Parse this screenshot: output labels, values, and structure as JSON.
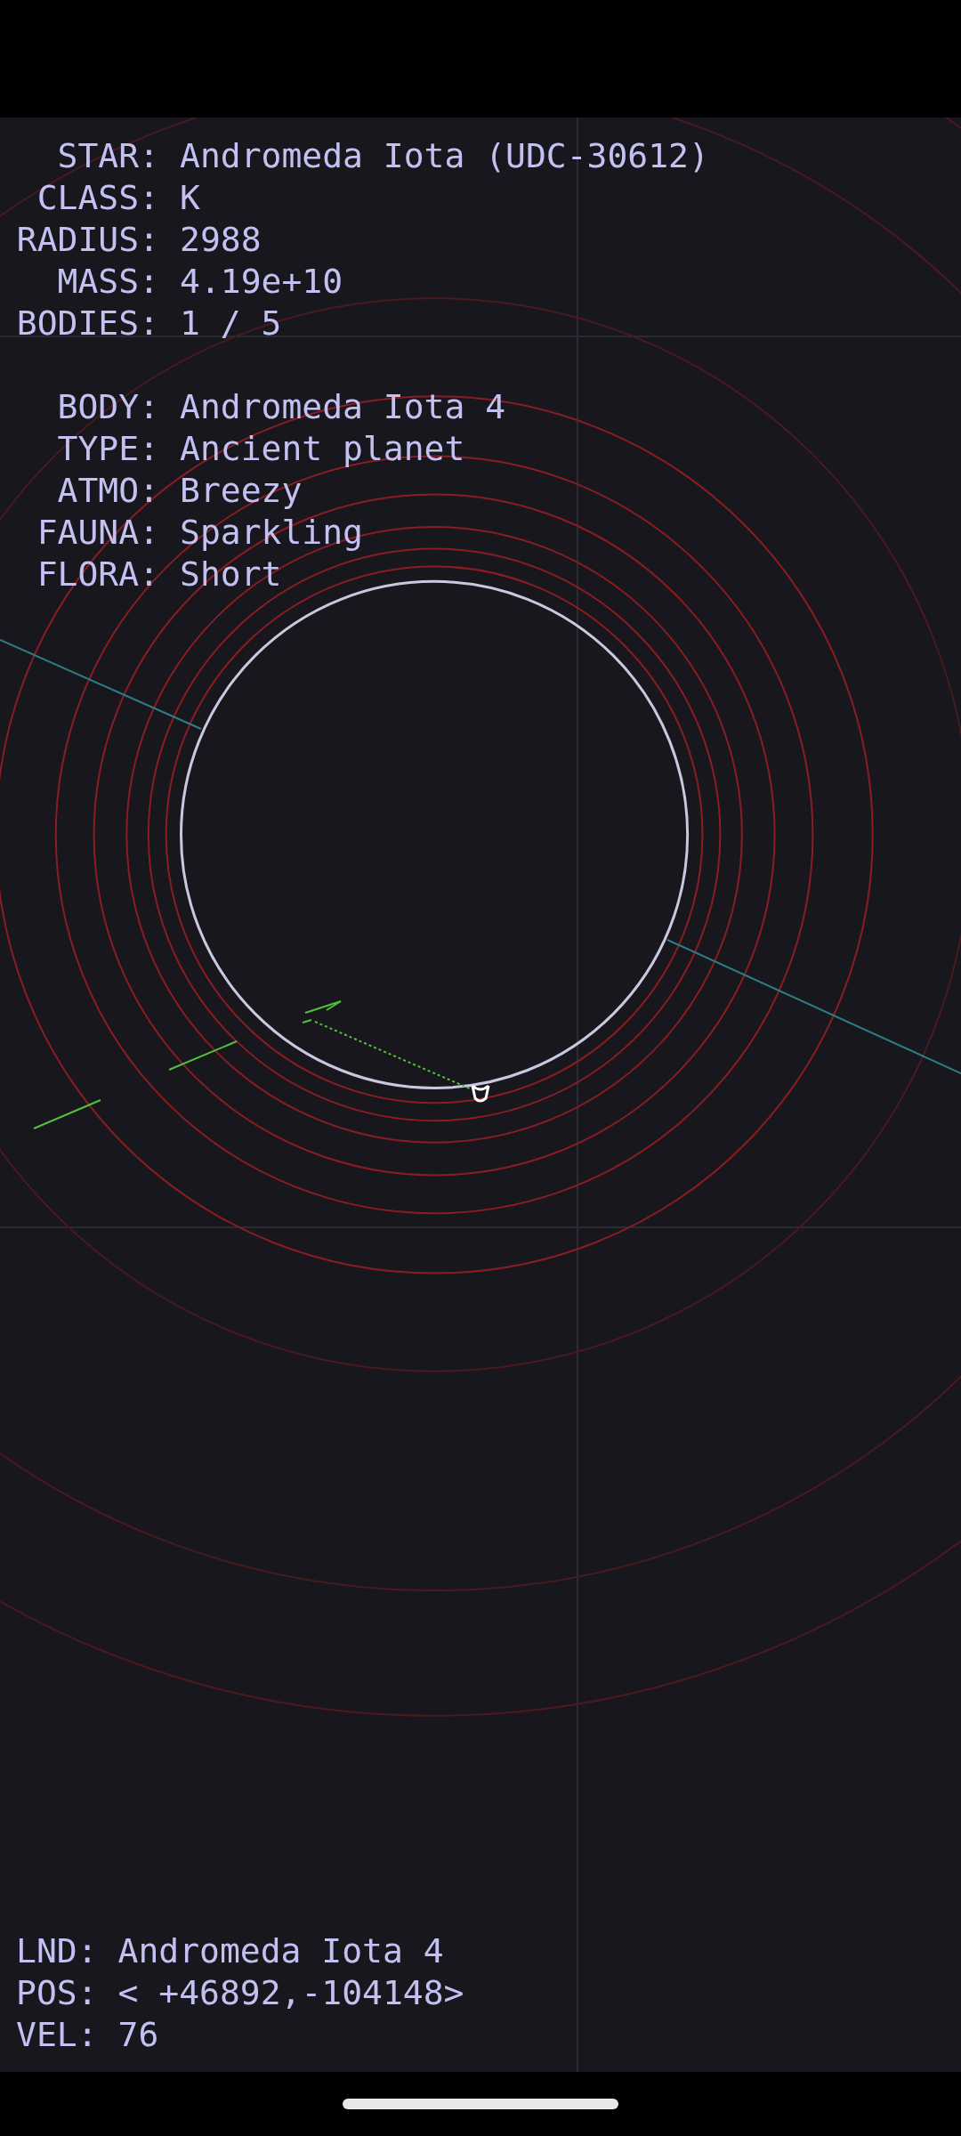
{
  "star": [
    {
      "label": "STAR:",
      "value": "Andromeda Iota (UDC-30612)"
    },
    {
      "label": "CLASS:",
      "value": "K"
    },
    {
      "label": "RADIUS:",
      "value": "2988"
    },
    {
      "label": "MASS:",
      "value": "4.19e+10"
    },
    {
      "label": "BODIES:",
      "value": "1 / 5"
    }
  ],
  "body": [
    {
      "label": "BODY:",
      "value": "Andromeda Iota 4"
    },
    {
      "label": "TYPE:",
      "value": "Ancient planet"
    },
    {
      "label": "ATMO:",
      "value": "Breezy"
    },
    {
      "label": "FAUNA:",
      "value": "Sparkling"
    },
    {
      "label": "FLORA:",
      "value": "Short"
    }
  ],
  "status": [
    {
      "label": "LND:",
      "value": "Andromeda Iota 4"
    },
    {
      "label": "POS:",
      "value": "< +46892,-104148>"
    },
    {
      "label": "VEL:",
      "value": "76"
    }
  ]
}
